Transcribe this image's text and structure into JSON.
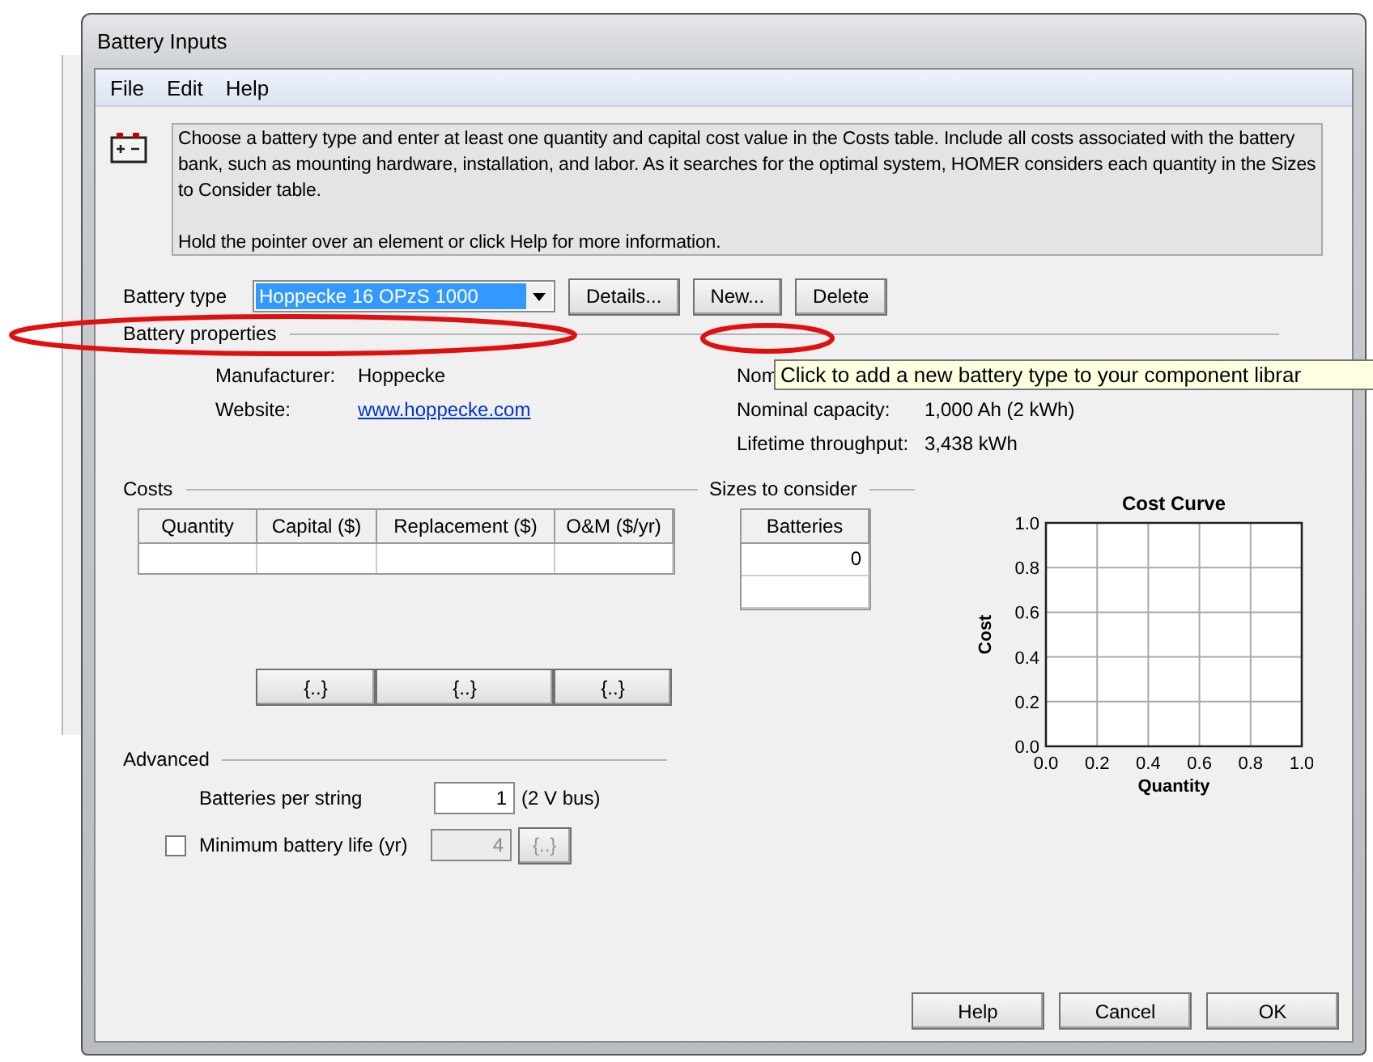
{
  "window": {
    "title": "Battery Inputs"
  },
  "menu": [
    {
      "label": "File"
    },
    {
      "label": "Edit"
    },
    {
      "label": "Help"
    }
  ],
  "info": {
    "text": "Choose a battery type and enter at least one quantity and capital cost value in the Costs table. Include all costs associated with the battery bank, such as mounting hardware, installation, and labor. As it searches for the optimal system, HOMER considers each quantity in the Sizes to Consider table.",
    "hint": "Hold the pointer over an element or click Help for more information."
  },
  "battery_type": {
    "label": "Battery type",
    "value": "Hoppecke 16 OPzS 1000",
    "buttons": [
      "Details...",
      "New...",
      "Delete"
    ]
  },
  "properties": {
    "title": "Battery properties",
    "left": [
      {
        "label": "Manufacturer:",
        "value": "Hoppecke",
        "kind": "text"
      },
      {
        "label": "Website:",
        "value": "www.hoppecke.com",
        "kind": "link"
      }
    ],
    "right": [
      {
        "label": "Nom",
        "kind": "text"
      },
      {
        "label": "Nominal capacity:",
        "value": "1,000 Ah   (2 kWh)",
        "kind": "text"
      },
      {
        "label": "Lifetime throughput:",
        "value": "3,438 kWh",
        "kind": "text"
      }
    ]
  },
  "tooltip": "Click to add a new battery type to your component librar",
  "costs": {
    "title": "Costs",
    "columns": [
      "Quantity",
      "Capital ($)",
      "Replacement ($)",
      "O&M ($/yr)"
    ],
    "row_buttons": [
      "{..}",
      "{..}",
      "{..}"
    ]
  },
  "sizes": {
    "title": "Sizes to consider",
    "column": "Batteries",
    "rows": [
      "0",
      ""
    ]
  },
  "advanced": {
    "title": "Advanced",
    "per_string": {
      "label": "Batteries per string",
      "value": "1",
      "unit": "(2 V bus)"
    },
    "min_life": {
      "label": "Minimum battery life (yr)",
      "checked": false,
      "value": "4",
      "button": "{..}",
      "disabled": true
    }
  },
  "chart_data": {
    "type": "line",
    "title": "Cost Curve",
    "xlabel": "Quantity",
    "ylabel": "Cost",
    "grid": true,
    "xlim": [
      0,
      1
    ],
    "ylim": [
      0,
      1
    ],
    "xticks": [
      {
        "value": 0,
        "label": "0.0"
      },
      {
        "value": 0.2,
        "label": "0.2"
      },
      {
        "value": 0.4,
        "label": "0.4"
      },
      {
        "value": 0.6,
        "label": "0.6"
      },
      {
        "value": 0.8,
        "label": "0.8"
      },
      {
        "value": 1,
        "label": "1.0"
      }
    ],
    "yticks": [
      {
        "value": 0,
        "label": "0.0"
      },
      {
        "value": 0.2,
        "label": "0.2"
      },
      {
        "value": 0.4,
        "label": "0.4"
      },
      {
        "value": 0.6,
        "label": "0.6"
      },
      {
        "value": 0.8,
        "label": "0.8"
      },
      {
        "value": 1,
        "label": "1.0"
      }
    ]
  },
  "footer_buttons": [
    "Help",
    "Cancel",
    "OK"
  ],
  "annotations": [
    {
      "kind": "ellipse"
    },
    {
      "kind": "ellipse"
    }
  ]
}
